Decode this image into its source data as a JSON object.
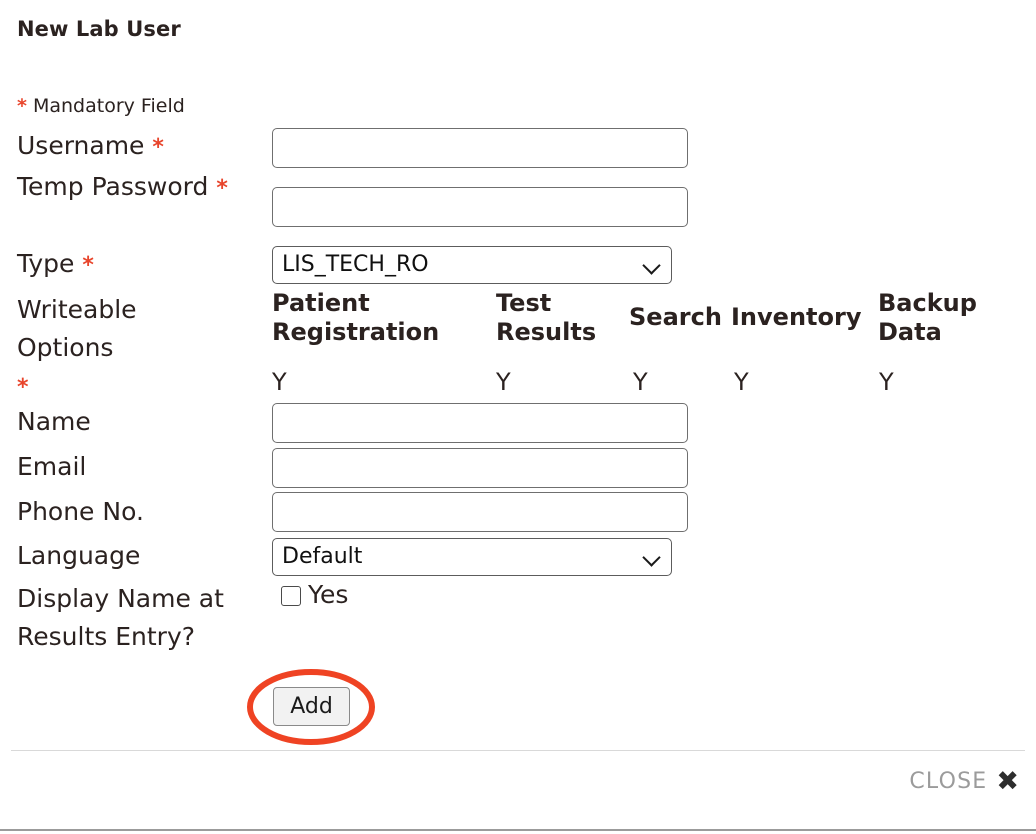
{
  "dialog": {
    "title": "New Lab User",
    "mandatory_note_symbol": "*",
    "mandatory_note_text": " Mandatory Field"
  },
  "form": {
    "username": {
      "label": "Username",
      "required": true,
      "value": "",
      "placeholder": ""
    },
    "temp_password": {
      "label": "Temp Password",
      "required": true,
      "value": "",
      "placeholder": ""
    },
    "type": {
      "label": "Type",
      "required": true,
      "selected": "LIS_TECH_RO",
      "options": [
        "LIS_TECH_RO"
      ]
    },
    "writeable_options": {
      "label_line1": "Writeable",
      "label_line2": "Options",
      "required": true,
      "columns": [
        {
          "header": "Patient Registration",
          "header_line1": "Patient",
          "header_line2": "Registration",
          "value": "Y"
        },
        {
          "header": "Test Results",
          "header_line1": "Test",
          "header_line2": "Results",
          "value": "Y"
        },
        {
          "header": "Search",
          "header_line1": "Search",
          "header_line2": "",
          "value": "Y"
        },
        {
          "header": "Inventory",
          "header_line1": "Inventory",
          "header_line2": "",
          "value": "Y"
        },
        {
          "header": "Backup Data",
          "header_line1": "Backup",
          "header_line2": "Data",
          "value": "Y"
        }
      ]
    },
    "name": {
      "label": "Name",
      "required": false,
      "value": "",
      "placeholder": ""
    },
    "email": {
      "label": "Email",
      "required": false,
      "value": "",
      "placeholder": ""
    },
    "phone": {
      "label": "Phone No.",
      "required": false,
      "value": "",
      "placeholder": ""
    },
    "language": {
      "label": "Language",
      "required": false,
      "selected": "Default",
      "options": [
        "Default"
      ]
    },
    "display_name": {
      "label": "Display Name at Results Entry?",
      "checkbox_label": "Yes",
      "checked": false
    }
  },
  "actions": {
    "add_label": "Add",
    "close_label": "CLOSE",
    "close_icon": "close-x-icon"
  },
  "annotation": {
    "shape": "ellipse",
    "target": "add-button",
    "color": "#ef4323"
  },
  "colors": {
    "required_asterisk": "#e8452c",
    "text": "#2b2220",
    "annotation": "#ef4323",
    "close_label": "#9b9b9b",
    "divider": "#d9d9d9"
  }
}
